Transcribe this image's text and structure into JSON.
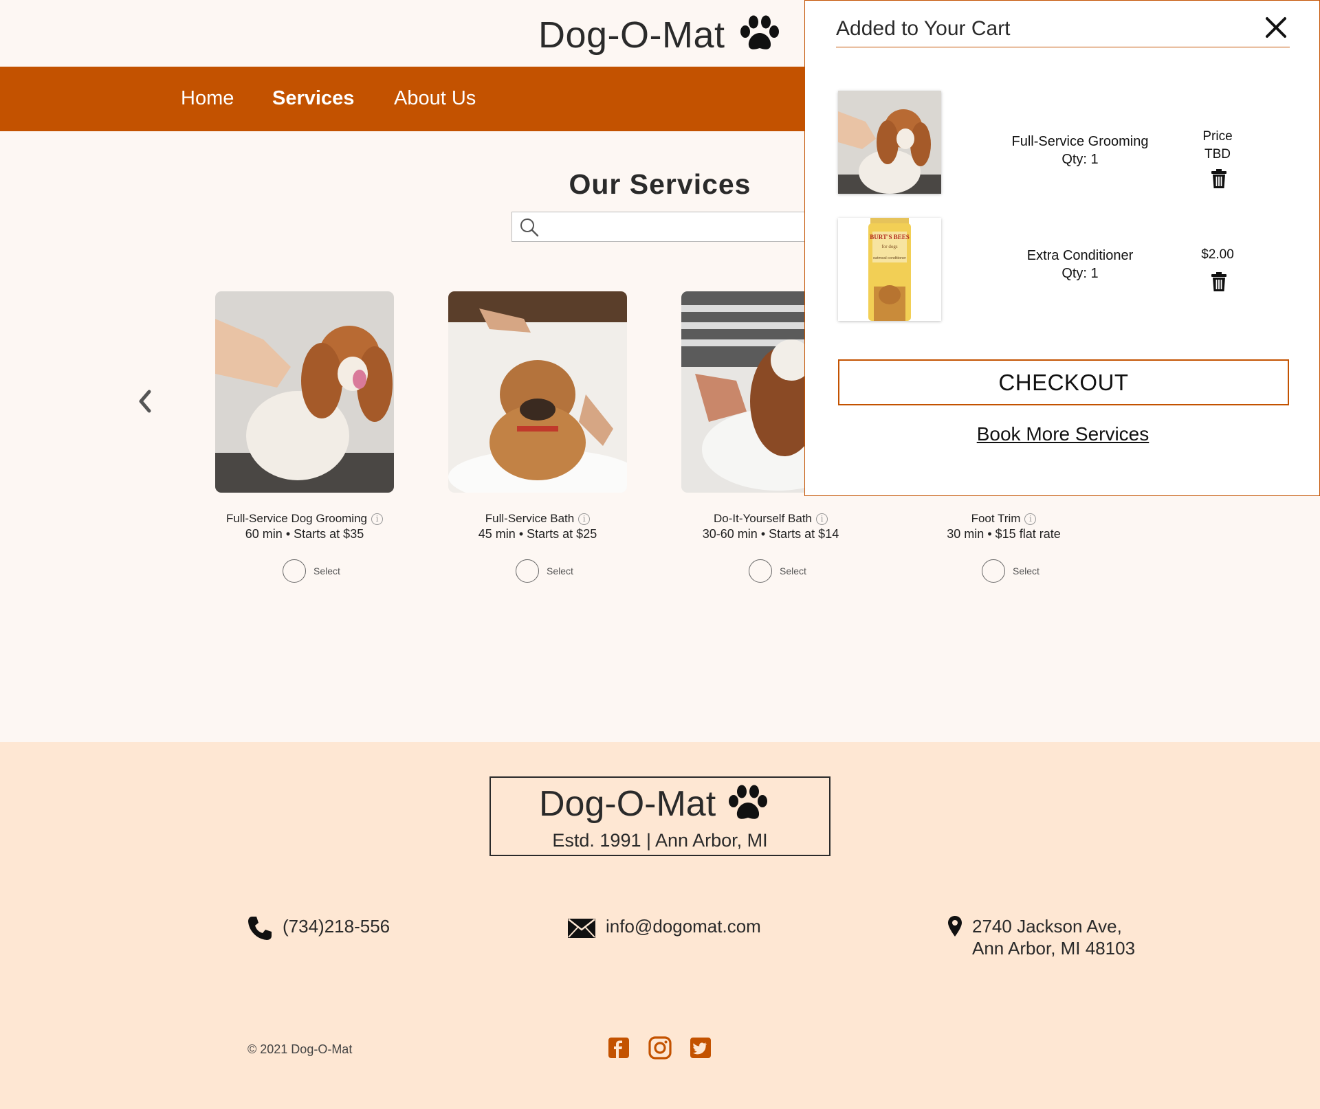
{
  "brand": {
    "name": "Dog-O-Mat",
    "est_line": "Estd. 1991 | Ann Arbor, MI",
    "accent": "#c35200",
    "footer_bg": "#fee7d3"
  },
  "nav": {
    "items": [
      {
        "label": "Home"
      },
      {
        "label": "Services"
      },
      {
        "label": "About Us"
      }
    ],
    "active": "Services"
  },
  "main": {
    "title": "Our Services",
    "search": {
      "placeholder": "",
      "value": ""
    },
    "services": [
      {
        "name": "Full-Service Dog Grooming",
        "duration": "60 min",
        "price": "Starts at $35",
        "select_label": "Select"
      },
      {
        "name": "Full-Service Bath",
        "duration": "45 min",
        "price": "Starts at $25",
        "select_label": "Select"
      },
      {
        "name": "Do-It-Yourself Bath",
        "duration": "30-60 min",
        "price": "Starts at $14",
        "select_label": "Select"
      },
      {
        "name": "Foot Trim",
        "duration": "30 min",
        "price": "$15 flat rate",
        "select_label": "Select"
      }
    ],
    "meta_separator": "•",
    "info_glyph": "i"
  },
  "cart": {
    "title": "Added to Your Cart",
    "items": [
      {
        "name": "Full-Service Grooming",
        "qty": "Qty: 1",
        "price_label": "Price",
        "price": "TBD"
      },
      {
        "name": "Extra Conditioner",
        "qty": "Qty: 1",
        "price": "$2.00"
      }
    ],
    "product_label": {
      "brand": "BURT'S BEES",
      "line": "for dogs",
      "product": "oatmeal conditioner"
    },
    "checkout_label": "CHECKOUT",
    "book_more_label": "Book More Services"
  },
  "footer": {
    "phone": "(734)218-556",
    "email": "info@dogomat.com",
    "address_line1": "2740 Jackson Ave,",
    "address_line2": "Ann Arbor, MI 48103",
    "copyright": "© 2021 Dog-O-Mat",
    "social": [
      "facebook-icon",
      "instagram-icon",
      "twitter-icon"
    ]
  }
}
